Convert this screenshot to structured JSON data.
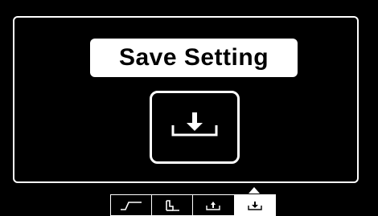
{
  "dialog": {
    "title": "Save Setting",
    "primary_icon": "download-to-tray-icon"
  },
  "tabs": [
    {
      "name": "waveform",
      "icon": "pulse-waveform-icon",
      "active": false
    },
    {
      "name": "step",
      "icon": "step-profile-icon",
      "active": false
    },
    {
      "name": "load",
      "icon": "upload-tray-icon",
      "active": false
    },
    {
      "name": "save",
      "icon": "download-tray-icon",
      "active": true
    }
  ],
  "colors": {
    "background": "#000000",
    "foreground": "#ffffff"
  }
}
